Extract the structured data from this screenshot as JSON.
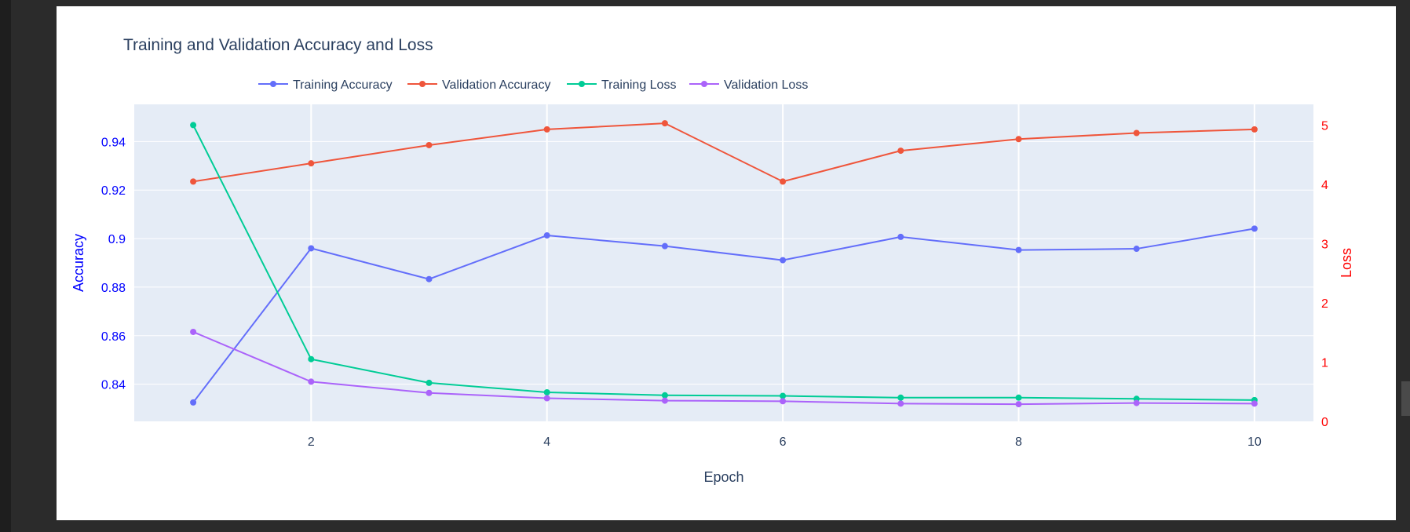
{
  "chart_data": {
    "type": "line",
    "title": "Training and Validation Accuracy and Loss",
    "xlabel": "Epoch",
    "ylabel": "Accuracy",
    "y2label": "Loss",
    "x": [
      1,
      2,
      3,
      4,
      5,
      6,
      7,
      8,
      9,
      10
    ],
    "xlim": [
      0.5,
      10.5
    ],
    "ylim": [
      0.8247,
      0.9553
    ],
    "y2lim": [
      0,
      5.35
    ],
    "xticks": [
      2,
      4,
      6,
      8,
      10
    ],
    "yticks": [
      0.84,
      0.86,
      0.88,
      0.9,
      0.92,
      0.94
    ],
    "y2ticks": [
      0,
      1,
      2,
      3,
      4,
      5
    ],
    "grid": true,
    "legend_position": "top",
    "series": [
      {
        "name": "Training Accuracy",
        "axis": "left",
        "color": "#636efa",
        "values": [
          0.8325,
          0.896,
          0.8833,
          0.9013,
          0.8969,
          0.8911,
          0.9007,
          0.8953,
          0.8958,
          0.9041
        ]
      },
      {
        "name": "Validation Accuracy",
        "axis": "left",
        "color": "#ef553b",
        "values": [
          0.9235,
          0.931,
          0.9385,
          0.945,
          0.9475,
          0.9235,
          0.9362,
          0.941,
          0.9435,
          0.945
        ]
      },
      {
        "name": "Training Loss",
        "axis": "right",
        "color": "#00cc96",
        "values": [
          5.0,
          1.05,
          0.65,
          0.49,
          0.44,
          0.43,
          0.4,
          0.4,
          0.38,
          0.36
        ]
      },
      {
        "name": "Validation Loss",
        "axis": "right",
        "color": "#ab63fa",
        "values": [
          1.51,
          0.67,
          0.48,
          0.39,
          0.35,
          0.34,
          0.3,
          0.29,
          0.31,
          0.3
        ]
      }
    ],
    "colors": {
      "plot_bg": "#e5ecf6",
      "grid": "#ffffff",
      "text": "#2a3f5f",
      "left_axis": "#0000ff",
      "right_axis": "#ff0000"
    }
  }
}
